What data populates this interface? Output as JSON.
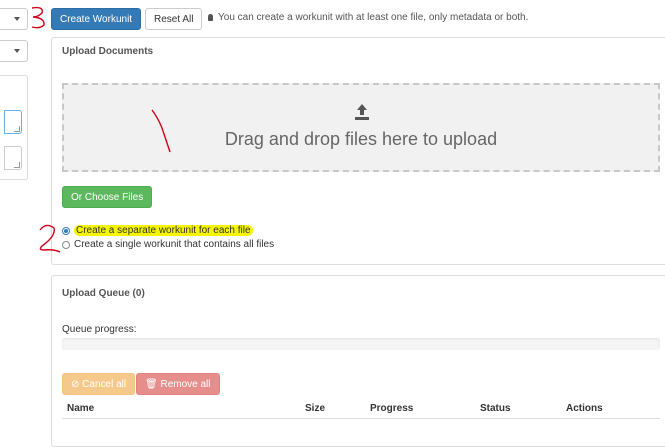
{
  "toolbar": {
    "create_label": "Create Workunit",
    "reset_label": "Reset All",
    "hint": "You can create a workunit with at least one file, only metadata or both."
  },
  "upload_documents": {
    "title": "Upload Documents",
    "dropzone_text": "Drag and drop files here to upload",
    "choose_label": "Or Choose Files",
    "options": [
      {
        "label": "Create a separate workunit for each file",
        "checked": true
      },
      {
        "label": "Create a single workunit that contains all files",
        "checked": false
      }
    ]
  },
  "upload_queue": {
    "title": "Upload Queue (0)",
    "progress_label": "Queue progress:",
    "progress_value": 0,
    "cancel_label": "Cancel all",
    "remove_label": "Remove all",
    "columns": [
      "Name",
      "Size",
      "Progress",
      "Status",
      "Actions"
    ]
  },
  "colors": {
    "primary": "#337ab7",
    "success": "#5cb85c",
    "warning": "#f0ad4e",
    "danger": "#d9534f",
    "highlight": "#f5f500",
    "annotation_red": "#d0021b"
  },
  "icons": [
    "upload-icon",
    "lightbulb-icon",
    "ban-icon",
    "trash-icon",
    "chevron-down-icon"
  ]
}
